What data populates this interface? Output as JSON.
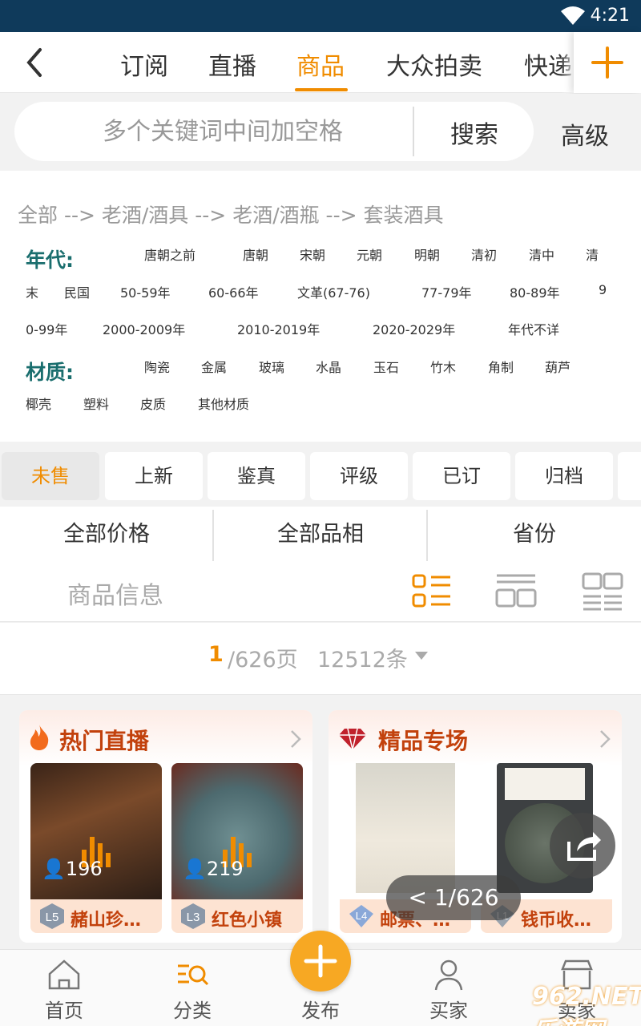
{
  "status_bar": {
    "time": "4:21"
  },
  "top_tabs": [
    {
      "label": "订阅",
      "active": false
    },
    {
      "label": "直播",
      "active": false
    },
    {
      "label": "商品",
      "active": true
    },
    {
      "label": "大众拍卖",
      "active": false
    },
    {
      "label": "快递",
      "active": false
    }
  ],
  "search": {
    "placeholder": "多个关键词中间加空格",
    "button": "搜索",
    "advanced": "高级"
  },
  "breadcrumb": "全部 --> 老酒/酒具 --> 老酒/酒瓶 --> 套装酒具",
  "filters": {
    "era_label": "年代:",
    "era_items": [
      "唐朝之前",
      "唐朝",
      "宋朝",
      "元朝",
      "明朝",
      "清初",
      "清中",
      "清",
      "末",
      "民国",
      "50-59年",
      "60-66年",
      "文革(67-76)",
      "77-79年",
      "80-89年",
      "9",
      "0-99年",
      "2000-2009年",
      "2010-2019年",
      "2020-2029年",
      "年代不详"
    ],
    "material_label": "材质:",
    "material_items": [
      "陶瓷",
      "金属",
      "玻璃",
      "水晶",
      "玉石",
      "竹木",
      "角制",
      "葫芦",
      "椰壳",
      "塑料",
      "皮质",
      "其他材质"
    ]
  },
  "chips": [
    {
      "label": "未售",
      "active": true
    },
    {
      "label": "上新",
      "active": false
    },
    {
      "label": "鉴真",
      "active": false
    },
    {
      "label": "评级",
      "active": false
    },
    {
      "label": "已订",
      "active": false
    },
    {
      "label": "归档",
      "active": false
    }
  ],
  "sort": {
    "price": "全部价格",
    "condition": "全部品相",
    "province": "省份"
  },
  "view": {
    "goods_info": "商品信息"
  },
  "pagination": {
    "current": "1",
    "total": "/626页",
    "count": "12512条"
  },
  "cards": {
    "hot_live": {
      "title": "热门直播",
      "items": [
        {
          "viewers": "196",
          "level": "L5",
          "name": "赭山珍…"
        },
        {
          "viewers": "219",
          "level": "L3",
          "name": "红色小镇"
        }
      ]
    },
    "premium": {
      "title": "精品专场",
      "items": [
        {
          "level": "L4",
          "name": "邮票、…"
        },
        {
          "level": "L1",
          "name": "钱币收…"
        }
      ]
    }
  },
  "overlay": {
    "pager": "< 1/626"
  },
  "bottom_nav": [
    {
      "label": "首页",
      "icon": "home-icon"
    },
    {
      "label": "分类",
      "icon": "category-icon"
    },
    {
      "label": "发布",
      "icon": "plus-icon"
    },
    {
      "label": "买家",
      "icon": "buyer-icon"
    },
    {
      "label": "卖家",
      "icon": "seller-icon"
    }
  ],
  "watermark": "962.NET 乐游网",
  "colors": {
    "accent": "#f08c00",
    "status_bar": "#0f3a5b",
    "filter_label": "#1a6e6e",
    "card_title": "#c2410c"
  }
}
